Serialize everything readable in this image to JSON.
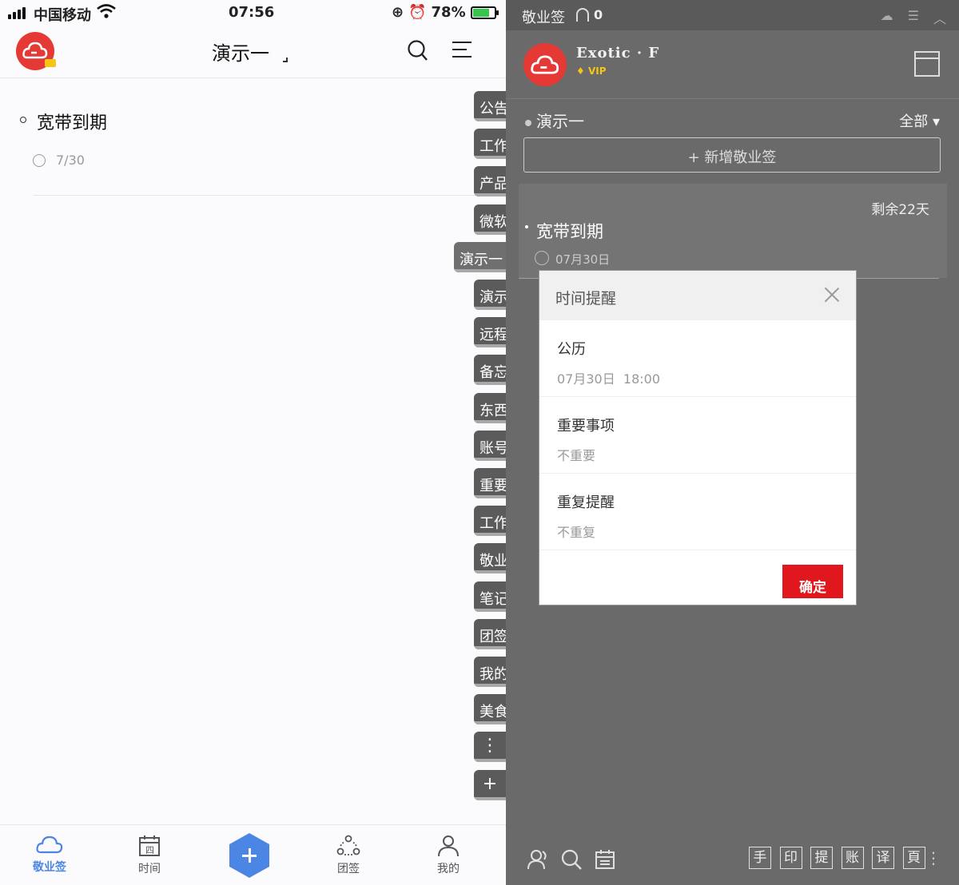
{
  "phone": {
    "status": {
      "carrier": "中国移动",
      "time": "07:56",
      "battery": "78%"
    },
    "appbar": {
      "title": "演示一"
    },
    "note": {
      "title": "宽带到期",
      "date": "7/30"
    },
    "tabs": [
      "公告",
      "工作",
      "产品",
      "微软",
      "演示一",
      "演示",
      "远程",
      "备忘",
      "东西",
      "账号",
      "重要",
      "工作",
      "敬业",
      "笔记",
      "团签",
      "我的",
      "美食",
      "⋮",
      "+"
    ],
    "active_tab_index": 4,
    "bottom_nav": [
      {
        "label": "敬业签",
        "icon": "cloud-icon",
        "active": true
      },
      {
        "label": "时间",
        "icon": "calendar-icon",
        "active": false
      },
      {
        "label": "团签",
        "icon": "team-icon",
        "active": false
      },
      {
        "label": "我的",
        "icon": "profile-icon",
        "active": false
      }
    ]
  },
  "desktop": {
    "title": "敬业签",
    "notify_count": "0",
    "user": {
      "name": "Exotic · F",
      "badge": "VIP"
    },
    "folder": "演示一",
    "filter": "全部",
    "add_label": "+ 新增敬业签",
    "note": {
      "remain": "剩余22天",
      "title": "宽带到期",
      "date": "07月30日"
    },
    "dialog": {
      "title": "时间提醒",
      "rows": [
        {
          "label": "公历",
          "value": "07月30日  18:00"
        },
        {
          "label": "重要事项",
          "value": "不重要"
        },
        {
          "label": "重复提醒",
          "value": "不重复"
        }
      ],
      "confirm": "确定"
    },
    "bottom_tools": [
      "手",
      "印",
      "提",
      "账",
      "译",
      "頁"
    ]
  },
  "colors": {
    "accent_blue": "#4b86e5",
    "brand_red": "#e53935",
    "confirm_red": "#e0181e"
  }
}
